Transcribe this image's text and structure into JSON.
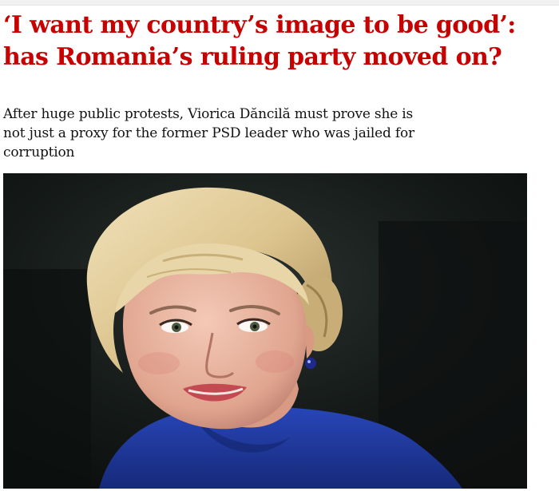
{
  "article": {
    "headline_lines": [
      "‘I want my country’s image to be good’:",
      "has Romania’s ruling party moved on?"
    ],
    "standfirst_lines": [
      "After huge public protests, Viorica Dăncilă must prove she is",
      "not just a proxy for the former PSD leader who was jailed for",
      "corruption"
    ]
  },
  "photo": {
    "subject": "portrait of a woman with blonde updo hair wearing a blue top",
    "background_color": "#101413",
    "hair_color": "#e3cf9f",
    "top_color": "#1f3a9e"
  },
  "colors": {
    "headline": "#c70000",
    "body_text": "#121212",
    "background": "#ffffff"
  }
}
